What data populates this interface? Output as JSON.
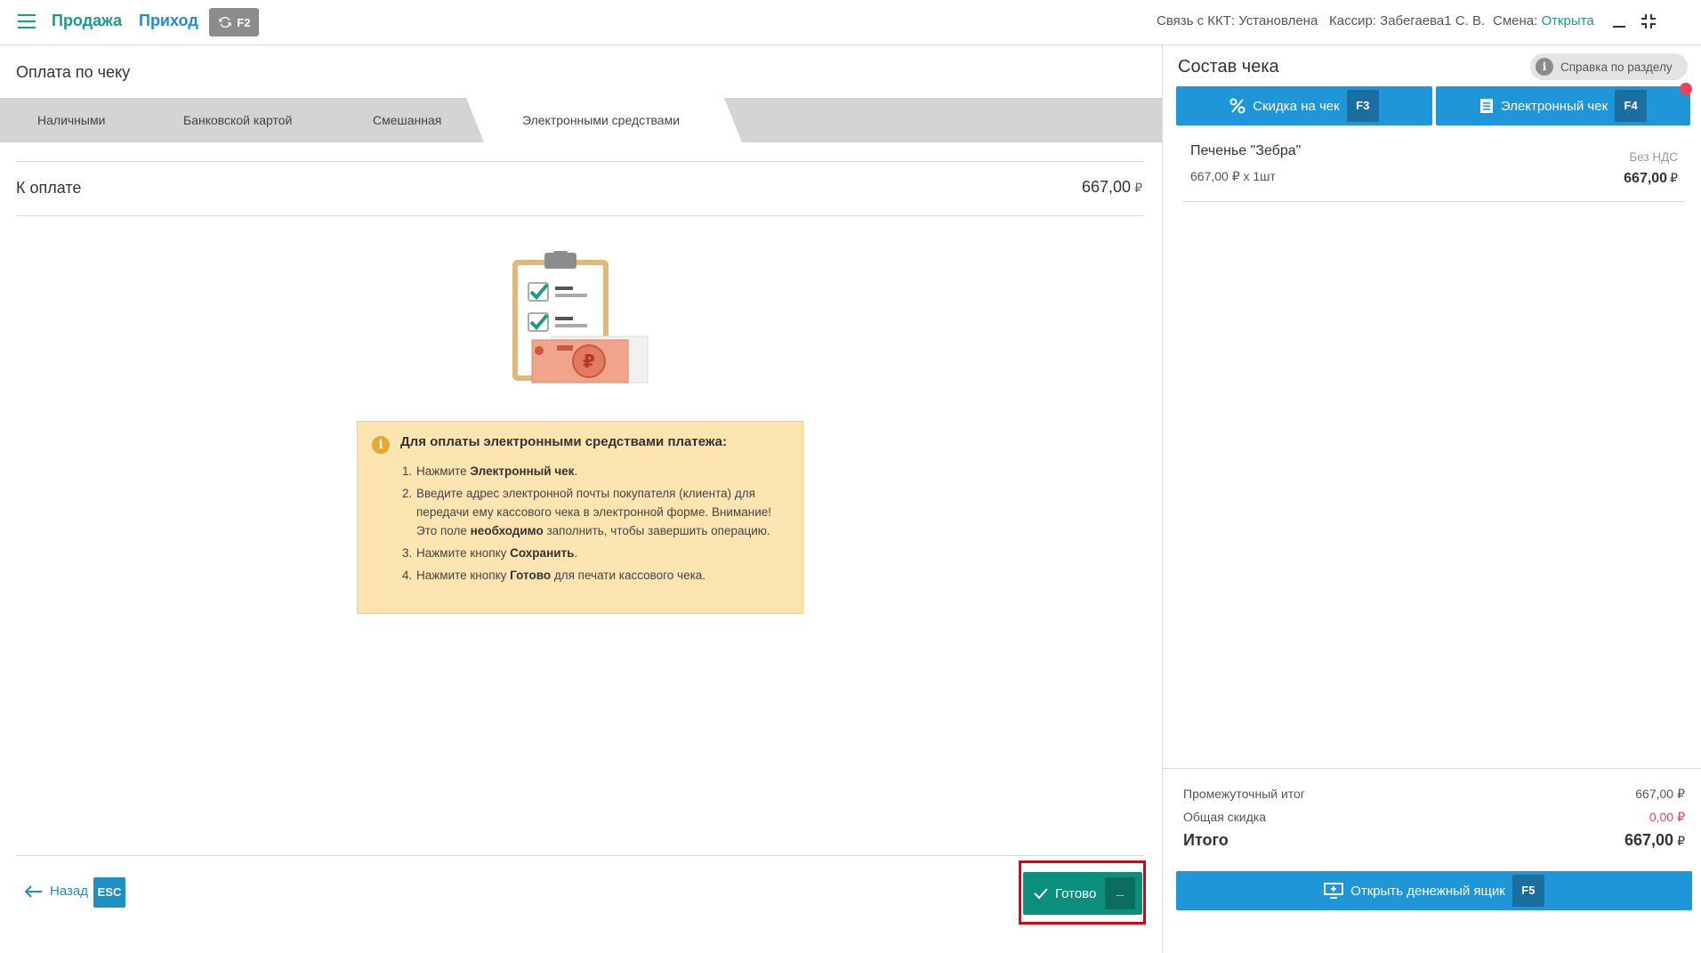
{
  "topbar": {
    "nav_sale": "Продажа",
    "nav_income": "Приход",
    "sync_key": "F2",
    "kkt_label": "Связь с ККТ:",
    "kkt_value": "Установлена",
    "cashier_label": "Кассир:",
    "cashier_value": "Забегаева1 С. В.",
    "shift_label": "Смена:",
    "shift_value": "Открыта"
  },
  "payment": {
    "title": "Оплата по чеку",
    "tabs": [
      {
        "label": "Наличными",
        "active": false
      },
      {
        "label": "Банковской картой",
        "active": false
      },
      {
        "label": "Смешанная",
        "active": false
      },
      {
        "label": "Электронными средствами",
        "active": true
      }
    ],
    "due_label": "К оплате",
    "due_value": "667,00",
    "currency": "₽"
  },
  "info": {
    "title": "Для оплаты электронными средствами платежа:",
    "steps": [
      {
        "num": "1.",
        "pre": "Нажмите ",
        "bold": "Электронный чек",
        "post": "."
      },
      {
        "num": "2.",
        "pre": "Введите адрес электронной почты покупателя (клиента) для передачи ему кассового чека в электронной форме. Внимание! Это поле ",
        "bold": "необходимо",
        "post": " заполнить, чтобы завершить операцию."
      },
      {
        "num": "3.",
        "pre": "Нажмите кнопку ",
        "bold": "Сохранить",
        "post": "."
      },
      {
        "num": "4.",
        "pre": "Нажмите кнопку ",
        "bold": "Готово",
        "post": " для печати кассового чека."
      }
    ]
  },
  "footer": {
    "back_label": "Назад",
    "back_key": "ESC",
    "ready_label": "Готово",
    "ready_key": "_"
  },
  "receipt": {
    "title": "Состав чека",
    "help_label": "Справка по разделу",
    "discount_label": "Скидка на чек",
    "discount_key": "F3",
    "echeck_label": "Электронный чек",
    "echeck_key": "F4",
    "items": [
      {
        "name": "Печенье \"Зебра\"",
        "qty": "667,00 ₽ х 1шт",
        "vat": "Без НДС",
        "price": "667,00"
      }
    ],
    "subtotal_label": "Промежуточный итог",
    "subtotal_value": "667,00",
    "discount_total_label": "Общая скидка",
    "discount_total_value": "0,00",
    "total_label": "Итого",
    "total_value": "667,00",
    "currency": "₽",
    "drawer_label": "Открыть денежный ящик",
    "drawer_key": "F5"
  },
  "colors": {
    "teal": "#1a9c8c",
    "blue": "#1e96d7",
    "ready_green": "#0d8f7d",
    "warning_bg": "#fde5b1",
    "highlight_red": "#e3000f",
    "negative": "#e8455a"
  }
}
